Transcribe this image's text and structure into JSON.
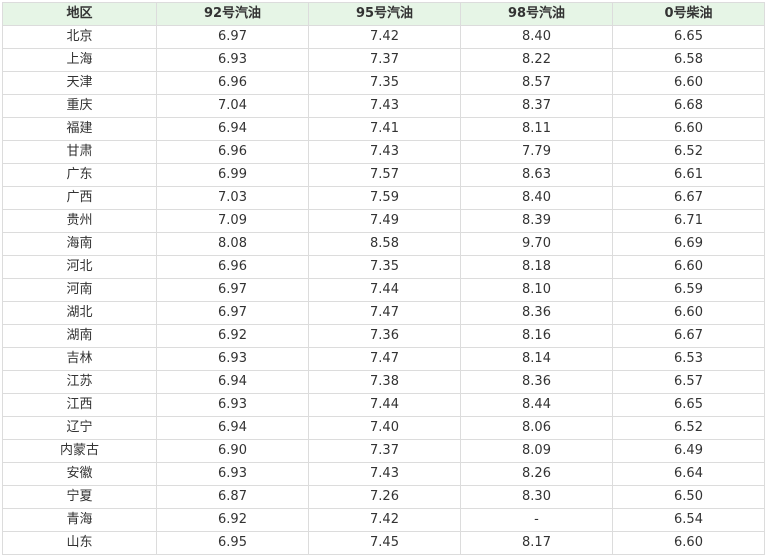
{
  "table": {
    "headers": [
      "地区",
      "92号汽油",
      "95号汽油",
      "98号汽油",
      "0号柴油"
    ],
    "rows": [
      [
        "北京",
        "6.97",
        "7.42",
        "8.40",
        "6.65"
      ],
      [
        "上海",
        "6.93",
        "7.37",
        "8.22",
        "6.58"
      ],
      [
        "天津",
        "6.96",
        "7.35",
        "8.57",
        "6.60"
      ],
      [
        "重庆",
        "7.04",
        "7.43",
        "8.37",
        "6.68"
      ],
      [
        "福建",
        "6.94",
        "7.41",
        "8.11",
        "6.60"
      ],
      [
        "甘肃",
        "6.96",
        "7.43",
        "7.79",
        "6.52"
      ],
      [
        "广东",
        "6.99",
        "7.57",
        "8.63",
        "6.61"
      ],
      [
        "广西",
        "7.03",
        "7.59",
        "8.40",
        "6.67"
      ],
      [
        "贵州",
        "7.09",
        "7.49",
        "8.39",
        "6.71"
      ],
      [
        "海南",
        "8.08",
        "8.58",
        "9.70",
        "6.69"
      ],
      [
        "河北",
        "6.96",
        "7.35",
        "8.18",
        "6.60"
      ],
      [
        "河南",
        "6.97",
        "7.44",
        "8.10",
        "6.59"
      ],
      [
        "湖北",
        "6.97",
        "7.47",
        "8.36",
        "6.60"
      ],
      [
        "湖南",
        "6.92",
        "7.36",
        "8.16",
        "6.67"
      ],
      [
        "吉林",
        "6.93",
        "7.47",
        "8.14",
        "6.53"
      ],
      [
        "江苏",
        "6.94",
        "7.38",
        "8.36",
        "6.57"
      ],
      [
        "江西",
        "6.93",
        "7.44",
        "8.44",
        "6.65"
      ],
      [
        "辽宁",
        "6.94",
        "7.40",
        "8.06",
        "6.52"
      ],
      [
        "内蒙古",
        "6.90",
        "7.37",
        "8.09",
        "6.49"
      ],
      [
        "安徽",
        "6.93",
        "7.43",
        "8.26",
        "6.64"
      ],
      [
        "宁夏",
        "6.87",
        "7.26",
        "8.30",
        "6.50"
      ],
      [
        "青海",
        "6.92",
        "7.42",
        "-",
        "6.54"
      ],
      [
        "山东",
        "6.95",
        "7.45",
        "8.17",
        "6.60"
      ]
    ]
  },
  "colors": {
    "header_background": "#e6f5e6",
    "border": "#dcdcdc",
    "text": "#333333"
  }
}
